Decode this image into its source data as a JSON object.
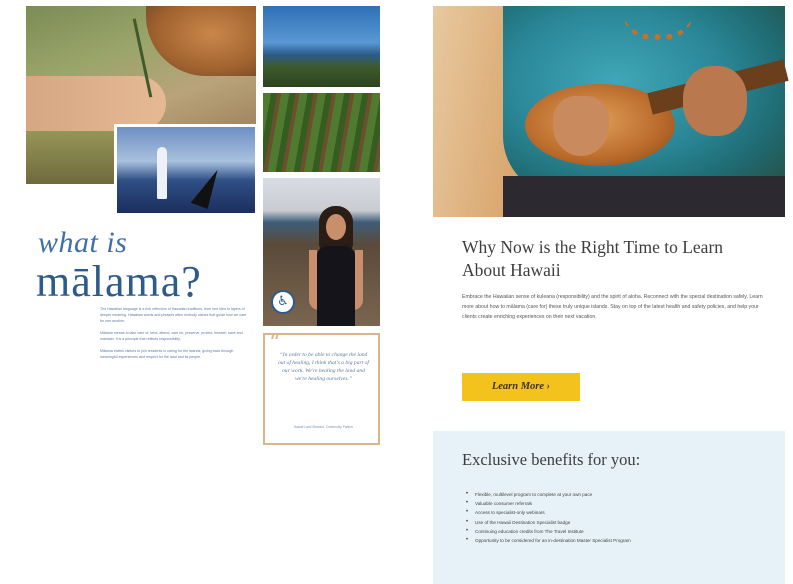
{
  "left_page": {
    "heading_line1": "what is",
    "heading_line2": "mālama?",
    "body_paragraphs": [
      "The Hawaiian language is a rich reflection of Hawaiian traditions, from one idea to layers of deeper meaning. Hawaiian words and phrases often embody values that guide how we care for one another.",
      "Mālama means to take care of, tend, attend, care for, preserve, protect, beware, save and maintain. It is a principle that reflects responsibility.",
      "Mālama invites visitors to join residents in caring for the islands, giving back through meaningful experiences and respect for the land and its people."
    ],
    "quote": {
      "mark": "“",
      "text": "“In order to be able to change the land out of healing, I think that's a big part of our work. We're healing the land and we're healing ourselves.”",
      "attribution": "Hawaii Land Steward, Community Partner"
    },
    "photo_badge_icon": "accessibility-icon",
    "photo_badge_glyph": "♿"
  },
  "right_page": {
    "section1": {
      "title": "Why Now is the Right Time to Learn About Hawaii",
      "body": "Embrace the Hawaiian sense of kuleana (responsibility) and the spirit of aloha. Reconnect with the special destination safely. Learn more about how to mālama (care for) these truly unique islands. Stay on top of the latest health and safety policies, and help your clients create enriching experiences on their next vacation.",
      "button_label": "Learn More ›"
    },
    "section2": {
      "title": "Exclusive benefits for you:",
      "items": [
        "Flexible, multilevel program to complete at your own pace",
        "Valuable consumer referrals",
        "Access to specialist-only webinars",
        "Use of the Hawaii Destination Specialist badge",
        "Continuing education credits from The Travel Institute",
        "Opportunity to be considered for an in-destination Master Specialist Program"
      ]
    },
    "colors": {
      "button": "#f4c21d",
      "benefits_bg": "#e6f1f8",
      "heading_blue": "#2d5b8c"
    }
  }
}
